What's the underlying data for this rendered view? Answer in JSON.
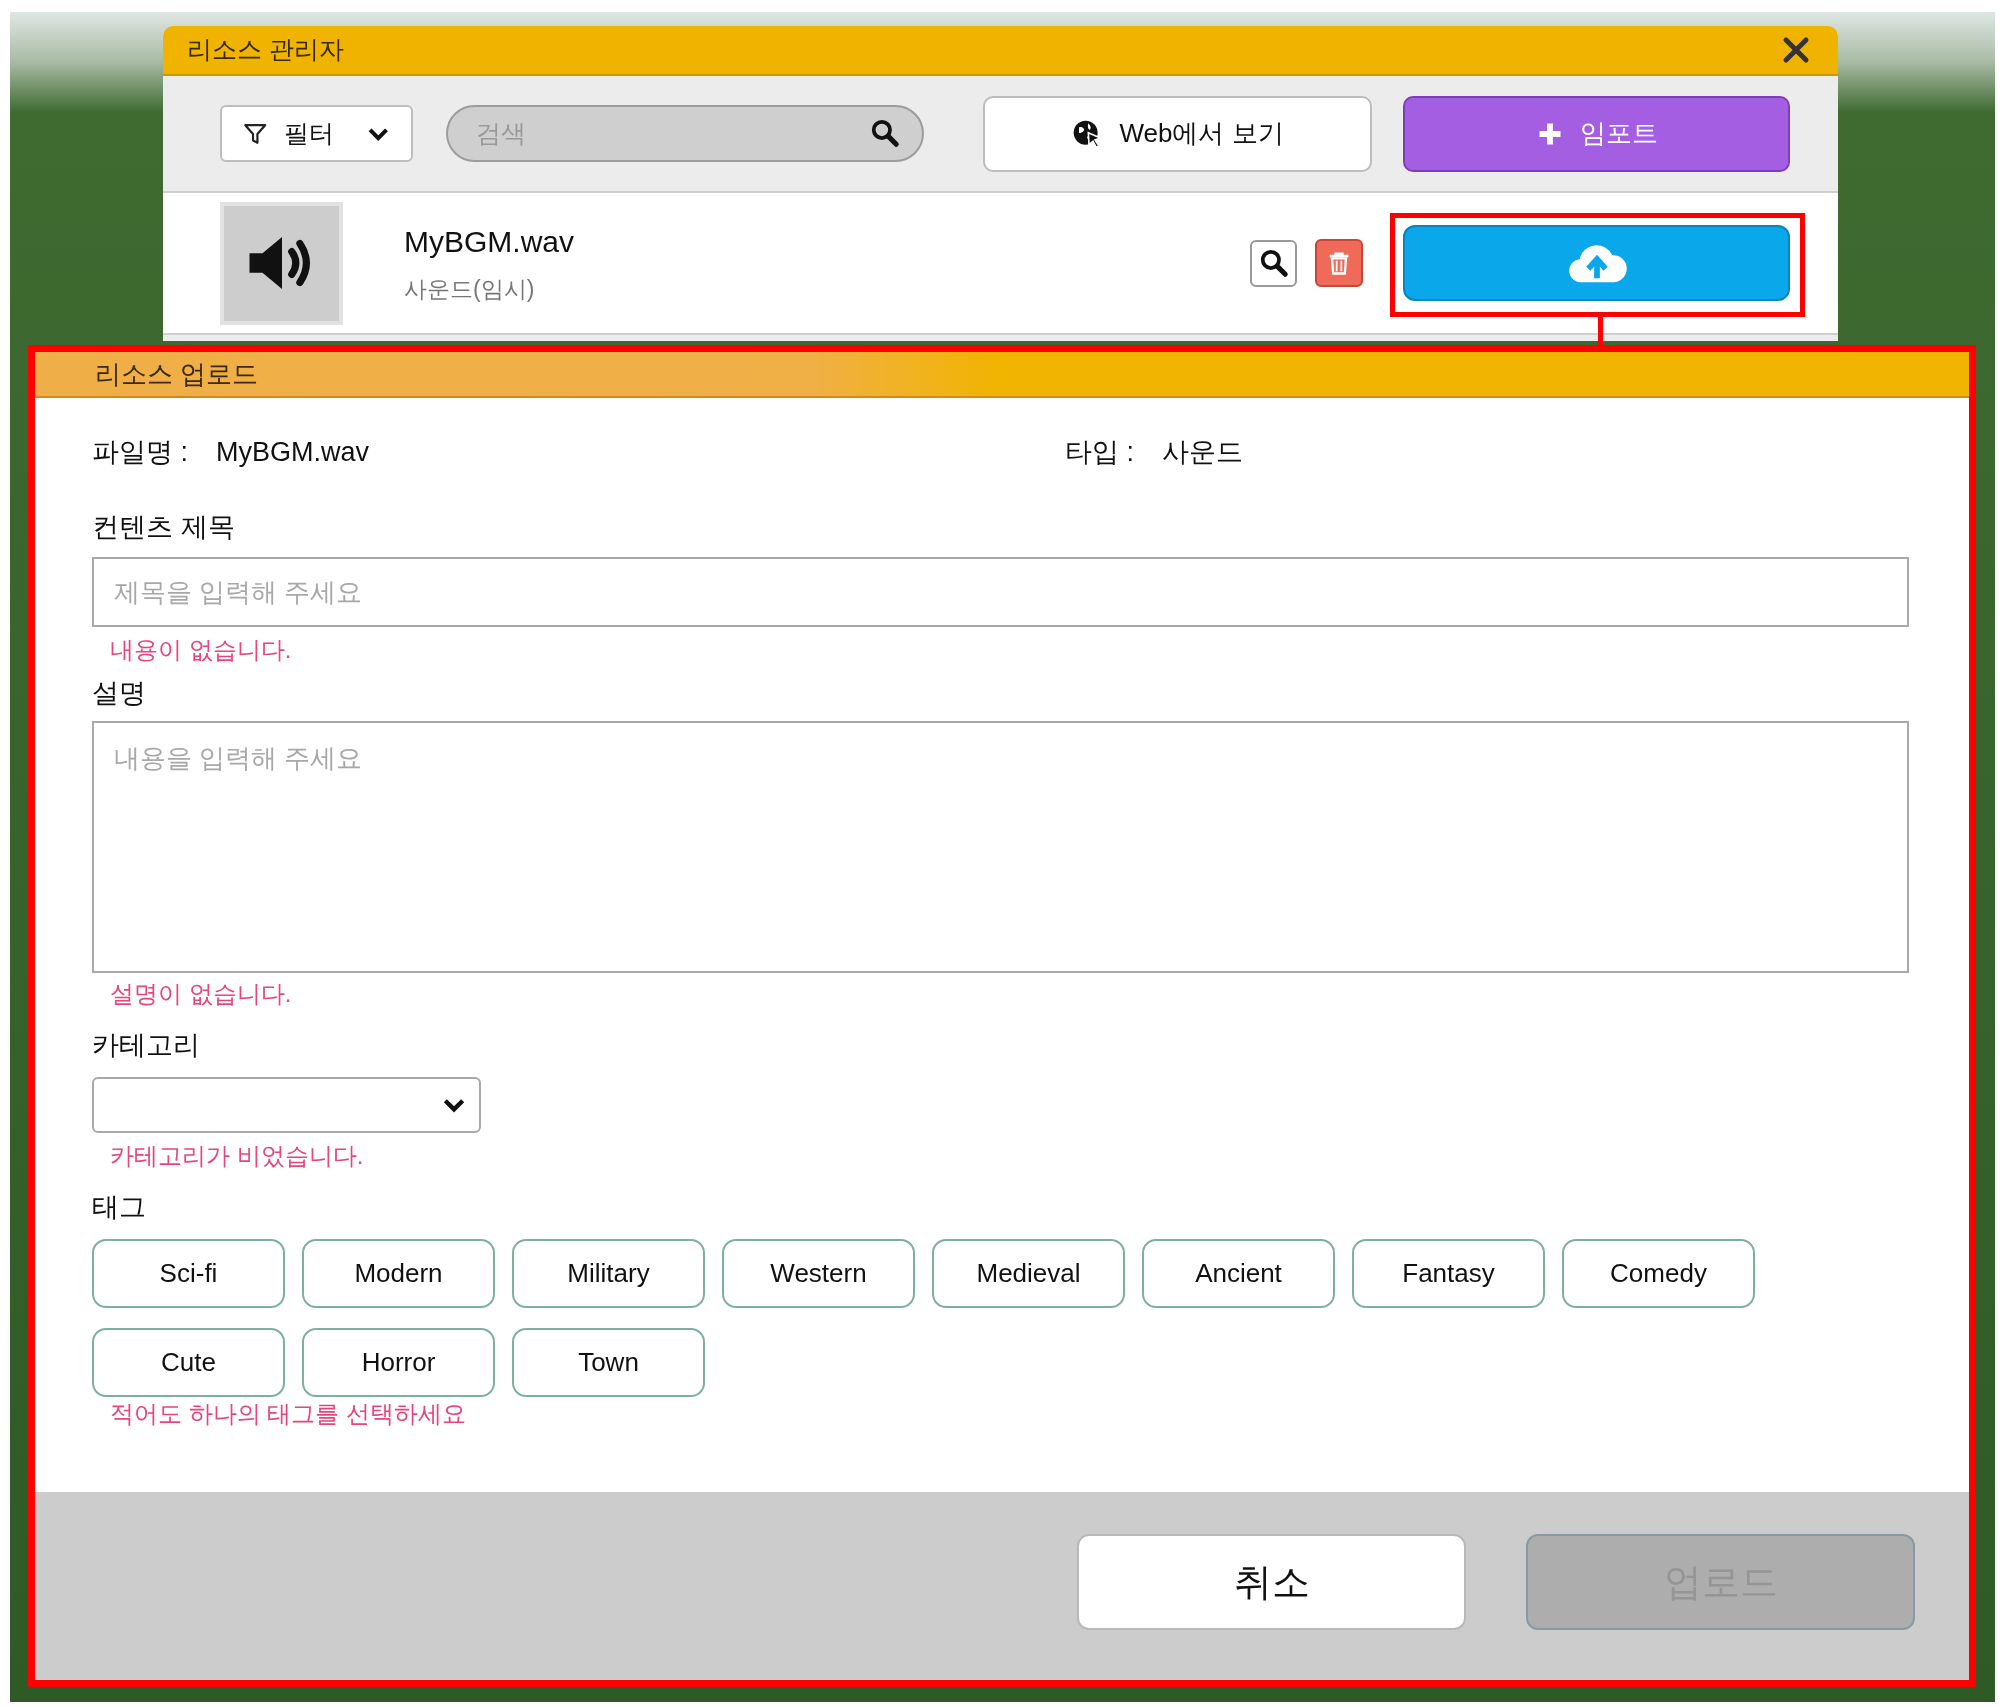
{
  "manager_window": {
    "title": "리소스 관리자",
    "toolbar": {
      "filter": {
        "label": "필터"
      },
      "search": {
        "placeholder": "검색"
      },
      "web_button": {
        "label": "Web에서 보기"
      },
      "import_button": {
        "label": "임포트"
      }
    },
    "resources": [
      {
        "name": "MyBGM.wav",
        "type": "사운드(임시)",
        "highlighted": true
      }
    ]
  },
  "upload_dialog": {
    "title": "리소스 업로드",
    "file_name": {
      "label": "파일명 :",
      "value": "MyBGM.wav"
    },
    "type": {
      "label": "타입 :",
      "value": "사운드"
    },
    "content_title": {
      "label": "컨텐츠 제목",
      "placeholder": "제목을 입력해 주세요",
      "error": "내용이 없습니다."
    },
    "description": {
      "label": "설명",
      "placeholder": "내용을 입력해 주세요",
      "error": "설명이 없습니다."
    },
    "category": {
      "label": "카테고리",
      "error": "카테고리가 비었습니다."
    },
    "tags": {
      "label": "태그",
      "items": [
        {
          "label": "Sci-fi",
          "selected": false
        },
        {
          "label": "Modern",
          "selected": false
        },
        {
          "label": "Military",
          "selected": false
        },
        {
          "label": "Western",
          "selected": false
        },
        {
          "label": "Medieval",
          "selected": false
        },
        {
          "label": "Ancient",
          "selected": false
        },
        {
          "label": "Fantasy",
          "selected": false
        },
        {
          "label": "Comedy",
          "selected": false
        },
        {
          "label": "Cute",
          "selected": false
        },
        {
          "label": "Horror",
          "selected": false
        },
        {
          "label": "Town",
          "selected": false
        }
      ],
      "error": "적어도 하나의 태그를 선택하세요"
    },
    "buttons": [
      {
        "label": "취소",
        "disabled": false
      },
      {
        "label": "업로드",
        "disabled": true
      }
    ]
  }
}
